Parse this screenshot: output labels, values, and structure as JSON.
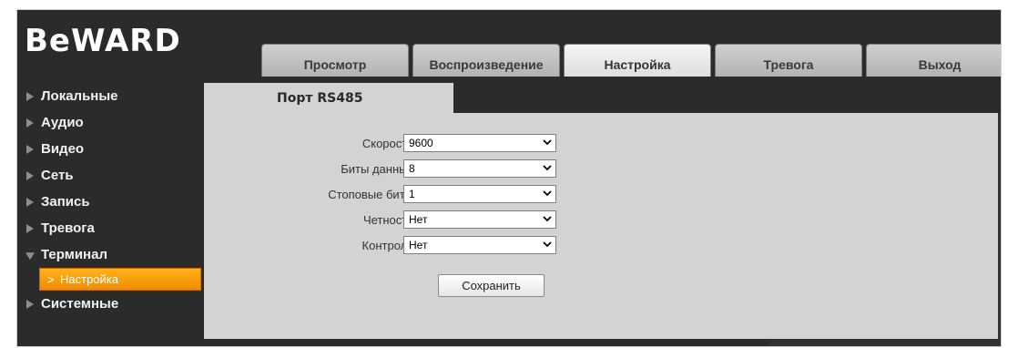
{
  "brand": {
    "logo_text": "BeWARD"
  },
  "tabs": [
    {
      "label": "Просмотр",
      "active": false
    },
    {
      "label": "Воспроизведение",
      "active": false
    },
    {
      "label": "Настройка",
      "active": true
    },
    {
      "label": "Тревога",
      "active": false
    },
    {
      "label": "Выход",
      "active": false
    }
  ],
  "sidebar": {
    "items": [
      {
        "label": "Локальные",
        "expanded": false
      },
      {
        "label": "Аудио",
        "expanded": false
      },
      {
        "label": "Видео",
        "expanded": false
      },
      {
        "label": "Сеть",
        "expanded": false
      },
      {
        "label": "Запись",
        "expanded": false
      },
      {
        "label": "Тревога",
        "expanded": false
      },
      {
        "label": "Терминал",
        "expanded": true
      },
      {
        "label": "Системные",
        "expanded": false
      }
    ],
    "active_sub": {
      "chevron": ">",
      "label": "Настройка"
    }
  },
  "section": {
    "title": "Порт RS485"
  },
  "form": {
    "fields": [
      {
        "label": "Скорость",
        "value": "9600"
      },
      {
        "label": "Биты данных",
        "value": "8"
      },
      {
        "label": "Стоповые биты",
        "value": "1"
      },
      {
        "label": "Четность",
        "value": "Нет"
      },
      {
        "label": "Контроль",
        "value": "Нет"
      }
    ],
    "save_label": "Сохранить"
  },
  "colors": {
    "frame": "#2b2b2b",
    "panel": "#d3d3d3",
    "accent": "#f7a000"
  }
}
